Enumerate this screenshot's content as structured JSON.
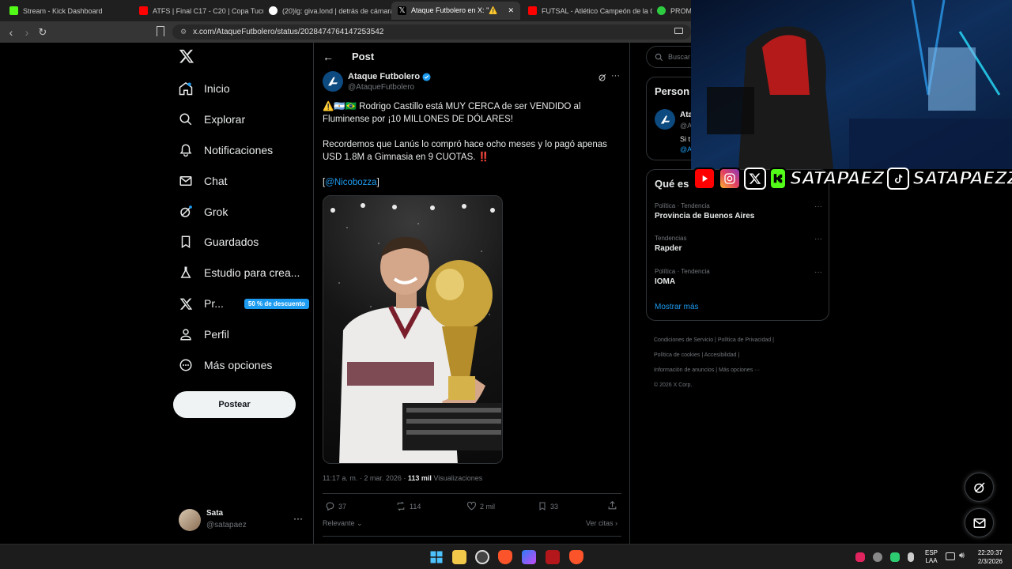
{
  "browser": {
    "tabs": [
      {
        "title": "Stream - Kick Dashboard",
        "favicon_color": "#53fc18"
      },
      {
        "title": "ATFS | Final C17 - C20 | Copa Tucumá",
        "favicon_color": "#ff0000"
      },
      {
        "title": "(20)lg: giva.lond | detrás de cámaras",
        "favicon_color": "#ffffff"
      },
      {
        "title": "Ataque Futbolero en X: \"⚠️",
        "favicon_color": "#ffffff"
      },
      {
        "title": "FUTSAL - Atlético Campeón de la Co",
        "favicon_color": "#ff0000"
      },
      {
        "title": "PROMI",
        "favicon_color": "#2ecc40"
      }
    ],
    "url": "x.com/AtaqueFutbolero/status/2028474764147253542"
  },
  "sidebar": {
    "items": [
      {
        "label": "Inicio",
        "icon": "home-icon"
      },
      {
        "label": "Explorar",
        "icon": "search-icon"
      },
      {
        "label": "Notificaciones",
        "icon": "bell-icon"
      },
      {
        "label": "Chat",
        "icon": "mail-icon"
      },
      {
        "label": "Grok",
        "icon": "grok-icon"
      },
      {
        "label": "Guardados",
        "icon": "bookmark-icon"
      },
      {
        "label": "Estudio para crea...",
        "icon": "flask-icon"
      },
      {
        "label": "Pr...",
        "icon": "x-logo-icon",
        "badge": "50 % de descuento"
      },
      {
        "label": "Perfil",
        "icon": "person-icon"
      },
      {
        "label": "Más opciones",
        "icon": "more-circle-icon"
      }
    ],
    "post_button": "Postear",
    "account": {
      "name": "Sata",
      "handle": "@satapaez"
    }
  },
  "post": {
    "header": "Post",
    "author_name": "Ataque Futbolero",
    "author_handle": "@AtaqueFutbolero",
    "text_line1": "⚠️🇦🇷🇧🇷 Rodrigo Castillo está MUY CERCA de ser VENDIDO al Fluminense por ¡10 MILLONES DE DÓLARES!",
    "text_line2": "Recordemos que Lanús lo compró hace ocho meses y lo pagó apenas USD 1.8M a Gimnasia en 9 CUOTAS. ‼️",
    "mention_open": "[",
    "mention": "@Nicobozza",
    "mention_close": "]",
    "timestamp": "11:17 a. m. · 2 mar. 2026 · ",
    "views_count": "113 mil",
    "views_label": " Visualizaciones",
    "stats": {
      "replies": "37",
      "reposts": "114",
      "likes": "2 mil",
      "bookmarks": "33"
    },
    "sort_label": "Relevante",
    "quotes_label": "Ver citas"
  },
  "right": {
    "search_placeholder": "Buscar",
    "who_to_follow_title": "Person",
    "suggestion": {
      "name": "Ata",
      "handle": "@A",
      "text": "Si t",
      "link": "@A"
    },
    "trends_title": "Qué es",
    "trends": [
      {
        "category": "Política · Tendencia",
        "name": "Provincia de Buenos Aires"
      },
      {
        "category": "Tendencias",
        "name": "Rapder"
      },
      {
        "category": "Política · Tendencia",
        "name": "IOMA"
      }
    ],
    "show_more": "Mostrar más",
    "footer": [
      "Condiciones de Servicio",
      "Política de Privacidad",
      "Política de cookies",
      "Accesibilidad",
      "Información de anuncios",
      "Más opciones ···",
      "© 2026 X Corp."
    ]
  },
  "overlay": {
    "handle1": "SATAPAEZ",
    "handle2": "SATAPAEZZ"
  },
  "taskbar": {
    "lang": "ESP",
    "lang2": "LAA",
    "time": "22:20:37",
    "date": "2/3/2026"
  },
  "colors": {
    "accent": "#1d9bf0",
    "background": "#000000",
    "border": "#2f3336"
  }
}
